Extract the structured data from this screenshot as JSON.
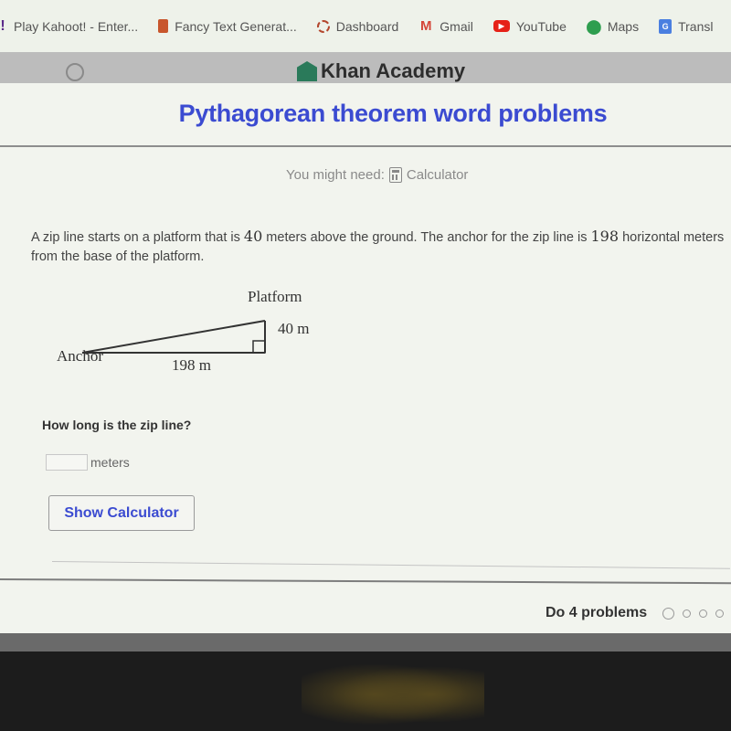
{
  "bookmarks": [
    {
      "icon": "kahoot-icon",
      "glyph": "!",
      "label": "Play Kahoot! - Enter..."
    },
    {
      "icon": "fancy-text-icon",
      "glyph": "",
      "label": "Fancy Text Generat..."
    },
    {
      "icon": "dashboard-icon",
      "glyph": "",
      "label": "Dashboard"
    },
    {
      "icon": "gmail-icon",
      "glyph": "M",
      "label": "Gmail"
    },
    {
      "icon": "youtube-icon",
      "glyph": "▶",
      "label": "YouTube"
    },
    {
      "icon": "maps-icon",
      "glyph": "⬤",
      "label": "Maps"
    },
    {
      "icon": "translate-icon",
      "glyph": "G",
      "label": "Transl"
    }
  ],
  "header": {
    "logo_text": "Khan Academy"
  },
  "exercise": {
    "title": "Pythagorean theorem word problems",
    "might_need_label": "You might need:",
    "tool_label": "Calculator",
    "question_part1": "A zip line starts on a platform that is ",
    "height_value": "40",
    "question_part2": " meters above the ground. The anchor for the zip line is ",
    "distance_value": "198",
    "question_part3": " horizontal meters from the base of the platform.",
    "diagram": {
      "top_label": "Platform",
      "vertical_label": "40 m",
      "left_label": "Anchor",
      "bottom_label": "198 m"
    },
    "prompt": "How long is the zip line?",
    "answer_value": "",
    "answer_unit": "meters",
    "show_calculator_label": "Show Calculator"
  },
  "footer": {
    "progress_label": "Do 4 problems",
    "total_problems": 4,
    "completed": 0
  }
}
